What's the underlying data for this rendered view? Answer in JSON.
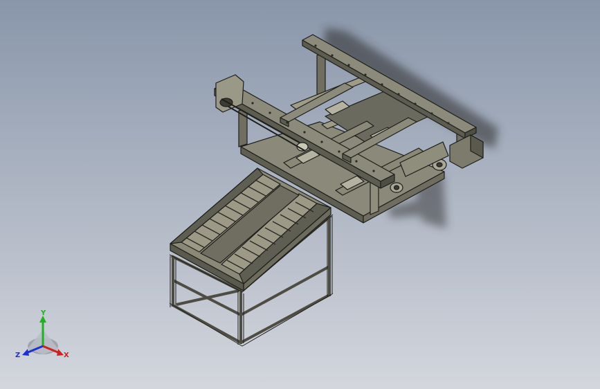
{
  "viewport": {
    "background_top": "#8996aa",
    "background_bottom": "#d3d6dd"
  },
  "model": {
    "body_color": "#7d7b6b",
    "shade_color": "#5b5a4e",
    "light_color": "#a3a18f",
    "edge_color": "#1e1e1a"
  },
  "triad": {
    "x_label": "X",
    "y_label": "Y",
    "z_label": "Z",
    "x_color": "#d21f1f",
    "y_color": "#1fb21f",
    "z_color": "#1f2fd2"
  }
}
